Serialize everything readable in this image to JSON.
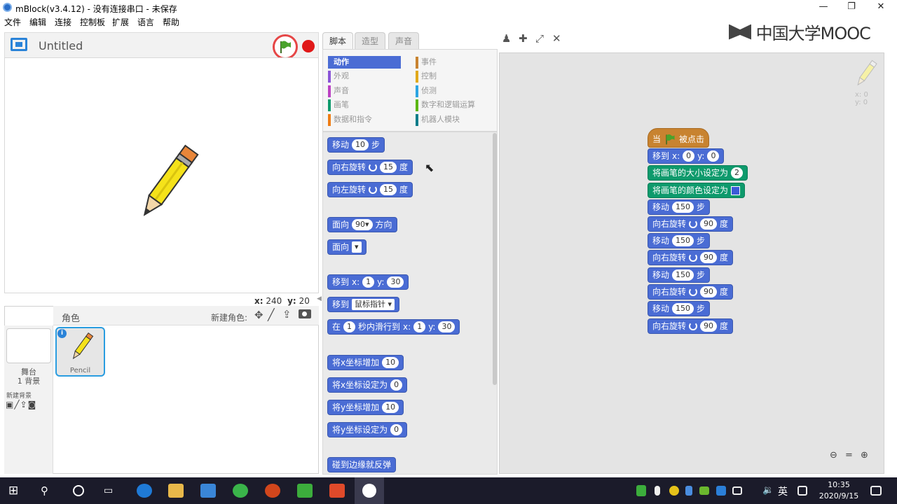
{
  "window": {
    "title": "mBlock(v3.4.12) - 没有连接串口 - 未保存",
    "minimize": "—",
    "restore": "❐",
    "close": "✕"
  },
  "menu": [
    "文件",
    "编辑",
    "连接",
    "控制板",
    "扩展",
    "语言",
    "帮助"
  ],
  "stage": {
    "title": "Untitled",
    "x_label": "x:",
    "x_value": "240",
    "y_label": "y:",
    "y_value": "20"
  },
  "sprites": {
    "header": "角色",
    "new_sprite_label": "新建角色:",
    "stage_label": "舞台",
    "backdrop_count": "1 背景",
    "new_backdrop": "新建背景",
    "sprite_name": "Pencil"
  },
  "tabs": [
    "脚本",
    "造型",
    "声音"
  ],
  "categories": [
    {
      "label": "动作",
      "color": "#4a6cd4",
      "active": true
    },
    {
      "label": "事件",
      "color": "#c88330"
    },
    {
      "label": "外观",
      "color": "#8a55d7"
    },
    {
      "label": "控制",
      "color": "#e1a91a"
    },
    {
      "label": "声音",
      "color": "#bb42c3"
    },
    {
      "label": "侦测",
      "color": "#2ca5e2"
    },
    {
      "label": "画笔",
      "color": "#0e9a6c"
    },
    {
      "label": "数字和逻辑运算",
      "color": "#5cb712"
    },
    {
      "label": "数据和指令",
      "color": "#ee7d16"
    },
    {
      "label": "机器人模块",
      "color": "#0e7d8a"
    }
  ],
  "palette": {
    "move": {
      "a": "移动",
      "n": "10",
      "b": "步"
    },
    "turn_right": {
      "a": "向右旋转",
      "n": "15",
      "b": "度"
    },
    "turn_left": {
      "a": "向左旋转",
      "n": "15",
      "b": "度"
    },
    "point_dir": {
      "a": "面向",
      "n": "90▾",
      "b": "方向"
    },
    "point_towards": {
      "a": "面向",
      "n": "▾"
    },
    "goto_xy": {
      "a": "移到",
      "x": "x:",
      "xn": "1",
      "y": "y:",
      "yn": "30"
    },
    "goto": {
      "a": "移到",
      "d": "鼠标指针 ▾"
    },
    "glide": {
      "a": "在",
      "n": "1",
      "b": "秒内滑行到",
      "x": "x:",
      "xn": "1",
      "y": "y:",
      "yn": "30"
    },
    "change_x": {
      "a": "将x坐标增加",
      "n": "10"
    },
    "set_x": {
      "a": "将x坐标设定为",
      "n": "0"
    },
    "change_y": {
      "a": "将y坐标增加",
      "n": "10"
    },
    "set_y": {
      "a": "将y坐标设定为",
      "n": "0"
    },
    "bounce": {
      "a": "碰到边缘就反弹"
    }
  },
  "script": {
    "hat": {
      "a": "当",
      "b": "被点击"
    },
    "goto": {
      "a": "移到",
      "x": "x:",
      "xn": "0",
      "y": "y:",
      "yn": "0"
    },
    "pen_size": {
      "a": "将画笔的大小设定为",
      "n": "2"
    },
    "pen_color": {
      "a": "将画笔的颜色设定为"
    },
    "steps": [
      {
        "a": "移动",
        "n": "150",
        "b": "步"
      },
      {
        "a": "向右旋转",
        "n": "90",
        "b": "度"
      },
      {
        "a": "移动",
        "n": "150",
        "b": "步"
      },
      {
        "a": "向右旋转",
        "n": "90",
        "b": "度"
      },
      {
        "a": "移动",
        "n": "150",
        "b": "步"
      },
      {
        "a": "向右旋转",
        "n": "90",
        "b": "度"
      },
      {
        "a": "移动",
        "n": "150",
        "b": "步"
      },
      {
        "a": "向右旋转",
        "n": "90",
        "b": "度"
      }
    ],
    "sprite_x": "x: 0",
    "sprite_y": "y: 0"
  },
  "watermark": "中国大学MOOC",
  "taskbar": {
    "lang": "英",
    "time": "10:35",
    "date": "2020/9/15"
  }
}
